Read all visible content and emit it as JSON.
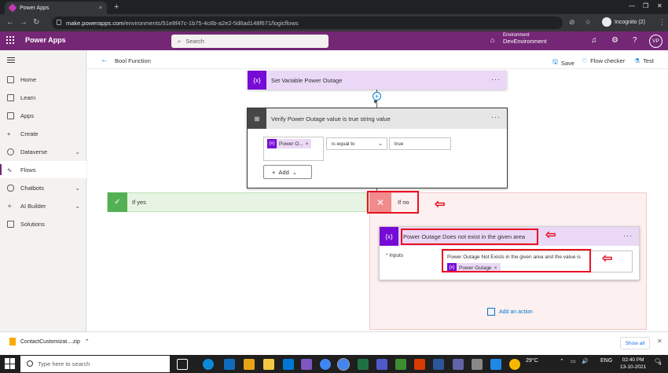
{
  "browser": {
    "tab_title": "Power Apps",
    "tab_close": "×",
    "new_tab": "+",
    "url_host": "make.powerapps.com",
    "url_path": "/environments/51e8f47c-1b75-4c8b-a2e2-5d6ad148f671/logicflows",
    "incognito_label": "Incognito (2)"
  },
  "header": {
    "app_name": "Power Apps",
    "search_placeholder": "Search",
    "env_label": "Environment",
    "env_name": "DevEnvironment",
    "avatar_initials": "VP"
  },
  "sidebar": {
    "items": [
      {
        "label": "Home"
      },
      {
        "label": "Learn"
      },
      {
        "label": "Apps"
      },
      {
        "label": "Create"
      },
      {
        "label": "Dataverse"
      },
      {
        "label": "Flows"
      },
      {
        "label": "Chatbots"
      },
      {
        "label": "AI Builder"
      },
      {
        "label": "Solutions"
      }
    ]
  },
  "toolbar": {
    "back_icon": "←",
    "flow_name": "Bool Function",
    "save_label": "Save",
    "flow_checker_label": "Flow checker",
    "test_label": "Test"
  },
  "flow": {
    "set_variable_title": "Set Variable Power Outage",
    "condition_title": "Verify Power Outage value is true string value",
    "condition_token": "Power O...",
    "condition_operator": "is equal to",
    "condition_value": "true",
    "add_label": "Add",
    "yes_label": "If yes",
    "no_label": "If no",
    "inner_action_title": "Power Outage Does not exist in the given area",
    "inputs_label": "Inputs",
    "inputs_required": "*",
    "inputs_text": "Power Outage Not Exists in the given area and the value is",
    "inputs_token": "Power Outage",
    "add_action_label": "Add an action",
    "more": "···",
    "var_icon": "{x}"
  },
  "downloads": {
    "file_name": "ContactCustomizat....zip",
    "show_all": "Show all"
  },
  "taskbar": {
    "search_placeholder": "Type here to search",
    "temperature": "29°C",
    "language": "ENG",
    "time": "02:40 PM",
    "date": "13-10-2021",
    "notification_count": "4"
  },
  "colors": {
    "brand": "#742774",
    "variable_accent": "#770bd6",
    "highlight_red": "#e81123",
    "yes_green": "#54b054",
    "no_red": "#f28b8b"
  }
}
